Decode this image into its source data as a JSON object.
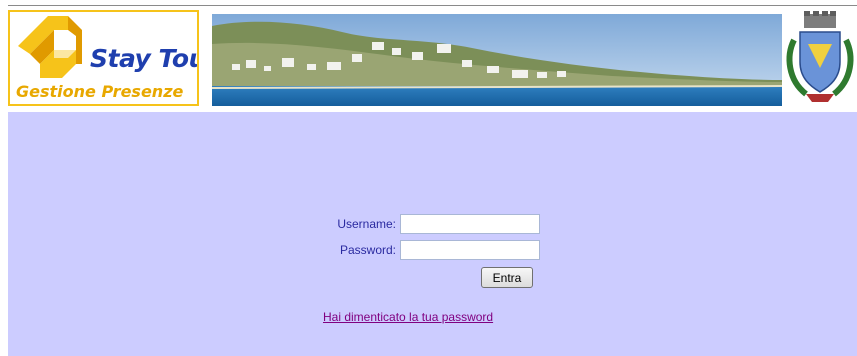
{
  "header": {
    "logo": {
      "name": "Stay Tour",
      "subtitle": "Gestione Presenze",
      "icon": "stay-tour-logo-mark"
    },
    "banner": {
      "icon": "coastal-town-photo"
    },
    "crest": {
      "icon": "municipal-coat-of-arms"
    }
  },
  "login": {
    "username_label": "Username:",
    "username_value": "",
    "password_label": "Password:",
    "password_value": "",
    "submit_label": "Entra",
    "forgot_link": "Hai dimenticato la tua password"
  },
  "colors": {
    "page_background": "#ccccff",
    "label_text": "#2a2aa0",
    "link_visited": "#800080",
    "logo_border": "#f6c31a",
    "logo_text": "#1f3fae"
  }
}
